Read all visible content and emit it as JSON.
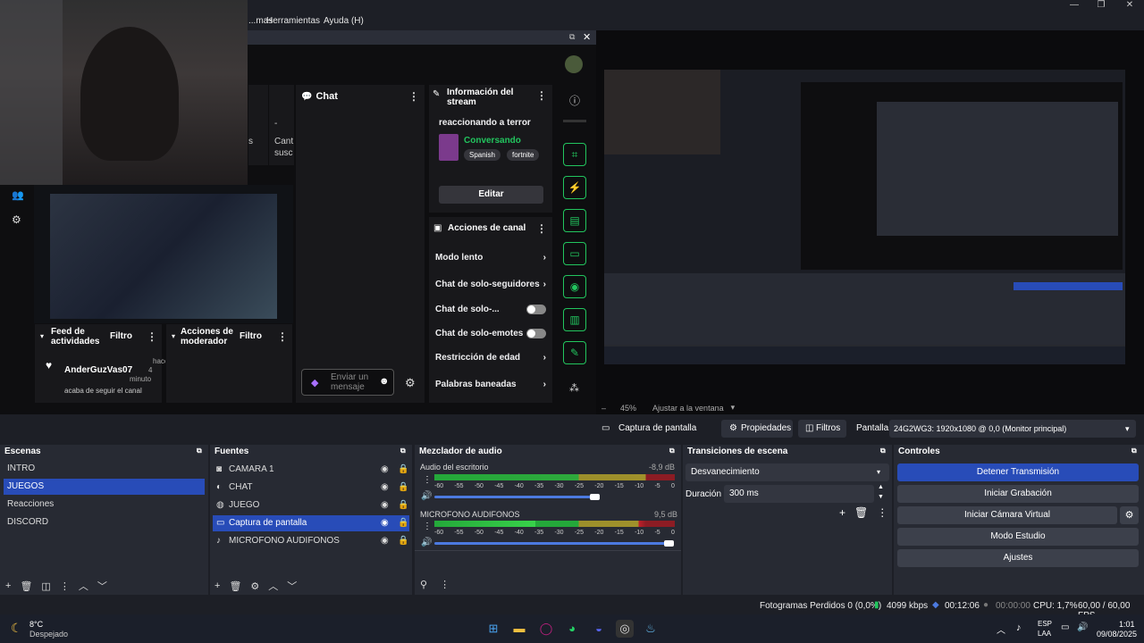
{
  "menubar": {
    "items": [
      "...mas",
      "Herramientas",
      "Ayuda (H)"
    ]
  },
  "dock": {
    "chat_title": "Chat",
    "stream_info": {
      "title": "Información del stream",
      "stream_title": "reaccionando a terror",
      "category": "Conversando",
      "tags": [
        "Spanish",
        "fortnite"
      ],
      "edit": "Editar"
    },
    "activity": {
      "title": "Feed de actividades",
      "filter": "Filtro",
      "user": "AnderGuzVas07",
      "time1": "hace",
      "time2": "4",
      "time3": "minuto",
      "event": "acaba de seguir el canal"
    },
    "mod_actions": {
      "title": "Acciones de moderador",
      "filter": "Filtro"
    },
    "channel_actions": {
      "title": "Acciones de canal",
      "items": [
        {
          "label": "Modo lento",
          "ctrl": "arrow"
        },
        {
          "label": "Chat de solo-seguidores",
          "ctrl": "arrow"
        },
        {
          "label": "Chat de solo-...",
          "ctrl": "toggle"
        },
        {
          "label": "Chat de solo-emotes",
          "ctrl": "toggle"
        },
        {
          "label": "Restricción de edad",
          "ctrl": "arrow"
        },
        {
          "label": "Palabras baneadas",
          "ctrl": "arrow"
        }
      ]
    },
    "chat_input_placeholder": "Enviar un mensaje",
    "partial_1": "-",
    "partial_2": "Cant",
    "partial_3": "susc",
    "partial_4": "s"
  },
  "preview": {
    "zoom": "45%",
    "fit": "Ajustar a la ventana",
    "minus": "–"
  },
  "source_toolbar": {
    "source": "Captura de pantalla",
    "properties": "Propiedades",
    "filters": "Filtros",
    "screen_label": "Pantalla",
    "screen_value": "24G2WG3: 1920x1080 @ 0,0 (Monitor principal)"
  },
  "scenes": {
    "title": "Escenas",
    "items": [
      "INTRO",
      "JUEGOS",
      "Reacciones",
      "DISCORD"
    ],
    "selected": 1
  },
  "sources": {
    "title": "Fuentes",
    "items": [
      {
        "name": "CAMARA 1",
        "icon": "camera-icon"
      },
      {
        "name": "CHAT",
        "icon": "browser-icon"
      },
      {
        "name": "JUEGO",
        "icon": "gamepad-icon"
      },
      {
        "name": "Captura de pantalla",
        "icon": "monitor-icon"
      },
      {
        "name": "MICROFONO AUDIFONOS",
        "icon": "mic-icon"
      }
    ],
    "selected": 3
  },
  "mixer": {
    "title": "Mezclador de audio",
    "channels": [
      {
        "name": "Audio del escritorio",
        "db": "-8,9 dB",
        "level": 0.98
      },
      {
        "name": "MICROFONO AUDIFONOS",
        "db": "9,5 dB",
        "level": 0.98
      }
    ],
    "ticks": [
      "-60",
      "-55",
      "-50",
      "-45",
      "-40",
      "-35",
      "-30",
      "-25",
      "-20",
      "-15",
      "-10",
      "-5",
      "0"
    ]
  },
  "transitions": {
    "title": "Transiciones de escena",
    "type": "Desvanecimiento",
    "duration_label": "Duración",
    "duration": "300 ms"
  },
  "controls": {
    "title": "Controles",
    "buttons": [
      "Detener Transmisión",
      "Iniciar Grabación",
      "Iniciar Cámara Virtual",
      "Modo Estudio",
      "Ajustes"
    ]
  },
  "status": {
    "dropped": "Fotogramas Perdidos 0 (0,0%)",
    "bitrate": "4099 kbps",
    "stream_time": "00:12:06",
    "rec_time": "00:00:00",
    "cpu": "CPU: 1,7%",
    "fps": "60,00 / 60,00 FPS"
  },
  "taskbar": {
    "temp": "8°C",
    "weather": "Despejado",
    "lang1": "ESP",
    "lang2": "LAA",
    "time": "1:01",
    "date": "09/08/2025"
  },
  "colors": {
    "accent": "#284cb8",
    "twitch_green": "#22c55e",
    "purple": "#a970ff"
  }
}
